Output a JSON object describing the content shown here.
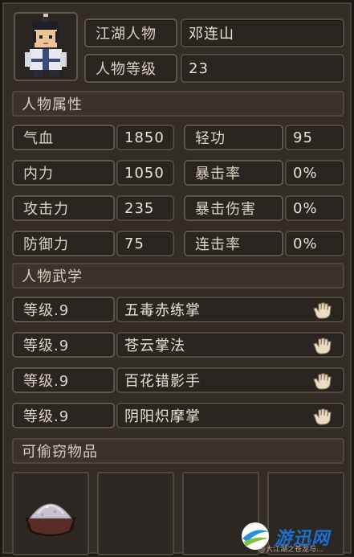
{
  "header": {
    "name_label": "江湖人物",
    "name_value": "邓连山",
    "level_label": "人物等级",
    "level_value": "23"
  },
  "sections": {
    "attributes": "人物属性",
    "martial": "人物武学",
    "stealable": "可偷窃物品"
  },
  "attributes": [
    {
      "label": "气血",
      "value": "1850"
    },
    {
      "label": "轻功",
      "value": "95"
    },
    {
      "label": "内力",
      "value": "1050"
    },
    {
      "label": "暴击率",
      "value": "0%"
    },
    {
      "label": "攻击力",
      "value": "235"
    },
    {
      "label": "暴击伤害",
      "value": "0%"
    },
    {
      "label": "防御力",
      "value": "75"
    },
    {
      "label": "连击率",
      "value": "0%"
    }
  ],
  "skills": [
    {
      "level": "等级.9",
      "name": "五毒赤练掌",
      "icon": "palm-icon"
    },
    {
      "level": "等级.9",
      "name": "苍云掌法",
      "icon": "palm-icon"
    },
    {
      "level": "等级.9",
      "name": "百花错影手",
      "icon": "palm-icon"
    },
    {
      "level": "等级.9",
      "name": "阴阳炽摩掌",
      "icon": "palm-icon"
    }
  ],
  "items": [
    {
      "icon": "salt-bowl-icon"
    },
    {
      "icon": ""
    },
    {
      "icon": ""
    },
    {
      "icon": ""
    }
  ],
  "watermark": {
    "logo_text": "游迅网",
    "credit": "@大江湖之苍龙与..."
  }
}
